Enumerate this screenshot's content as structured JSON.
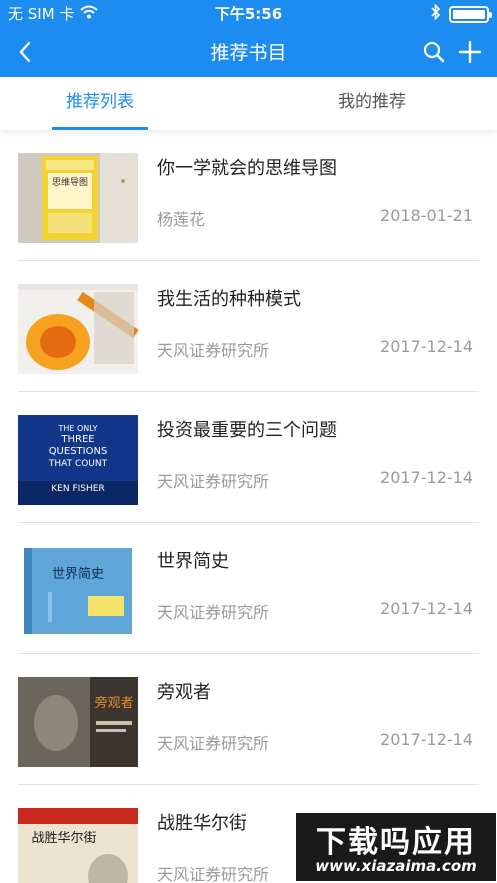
{
  "status_bar": {
    "carrier": "无 SIM 卡",
    "time": "下午5:56"
  },
  "nav": {
    "title": "推荐书目",
    "icons": [
      "back-arrow-icon",
      "search-icon",
      "plus-icon"
    ]
  },
  "tabs": [
    {
      "label": "推荐列表",
      "active": true
    },
    {
      "label": "我的推荐",
      "active": false
    }
  ],
  "books": [
    {
      "title": "你一学就会的思维导图",
      "author": "杨莲花",
      "date": "2018-01-21"
    },
    {
      "title": "我生活的种种模式",
      "author": "天风证券研究所",
      "date": "2017-12-14"
    },
    {
      "title": "投资最重要的三个问题",
      "author": "天风证券研究所",
      "date": "2017-12-14"
    },
    {
      "title": "世界简史",
      "author": "天风证券研究所",
      "date": "2017-12-14"
    },
    {
      "title": "旁观者",
      "author": "天风证券研究所",
      "date": "2017-12-14"
    },
    {
      "title": "战胜华尔街",
      "author": "天风证券研究所",
      "date": ""
    }
  ],
  "covers": {
    "book1": {
      "text": "思维导图"
    },
    "book3": {
      "line1": "THE ONLY",
      "line2": "THREE",
      "line3": "QUESTIONS",
      "line4": "THAT COUNT",
      "author": "KEN FISHER"
    },
    "book4": {
      "text": "世界简史"
    },
    "book5": {
      "text": "旁观者"
    },
    "book6": {
      "text": "战胜华尔街"
    }
  },
  "watermark": {
    "main": "下载吗应用",
    "sub": "www.xiazaima.com"
  },
  "colors": {
    "accent": "#1d8cf0",
    "text_primary": "#222222",
    "text_secondary": "#9a9a9a"
  }
}
